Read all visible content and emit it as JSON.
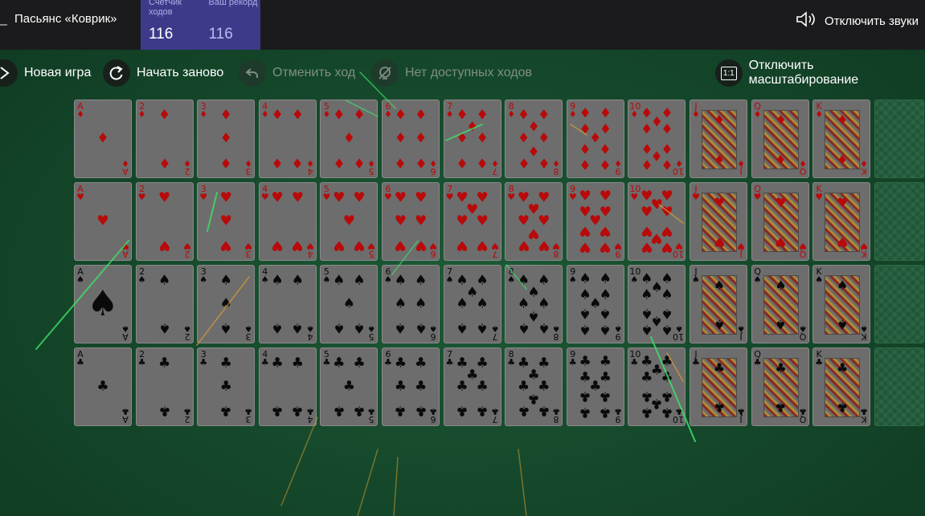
{
  "header": {
    "title": "Пасьянс «Коврик»",
    "moves_label": "Счетчик ходов",
    "moves_value": "116",
    "record_label": "Ваш рекорд",
    "record_value": "116",
    "sound_label": "Отключить звуки"
  },
  "toolbar": {
    "new_game": "Новая игра",
    "restart": "Начать заново",
    "undo": "Отменить ход",
    "no_moves": "Нет доступных ходов",
    "scale": "Отключить масштабирование",
    "scale_icon_text": "1:1"
  },
  "colors": {
    "red_suit": "#b80a0a",
    "black_suit": "#0a0a0a",
    "table": "#164a2c",
    "stats_bg": "#3d3a8a"
  },
  "ranks": [
    "A",
    "2",
    "3",
    "4",
    "5",
    "6",
    "7",
    "8",
    "9",
    "10",
    "J",
    "Q",
    "K"
  ],
  "suits": [
    {
      "name": "diamonds",
      "symbol": "♦",
      "color": "red"
    },
    {
      "name": "hearts",
      "symbol": "♥",
      "color": "red"
    },
    {
      "name": "spades",
      "symbol": "♠",
      "color": "black"
    },
    {
      "name": "clubs",
      "symbol": "♣",
      "color": "black"
    }
  ],
  "stock_cards": 4
}
